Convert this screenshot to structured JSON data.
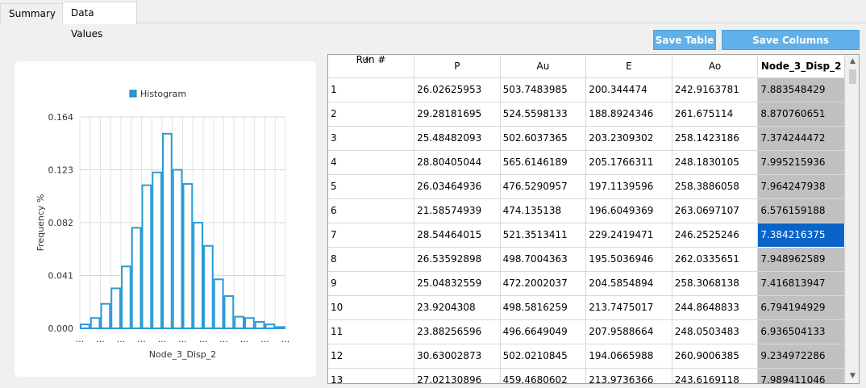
{
  "tabs": [
    {
      "label": "Summary",
      "active": false
    },
    {
      "label": "Data Values",
      "active": true
    }
  ],
  "buttons": {
    "save_table": "Save Table",
    "save_columns": "Save Columns Separately"
  },
  "colors": {
    "accent": "#62b0ea",
    "histogram": "#2a9bd7",
    "selection": "#0a64c8",
    "selected_column": "#c0c0c0"
  },
  "chart_data": {
    "type": "bar",
    "legend": "Histogram",
    "xlabel": "Node_3_Disp_2",
    "ylabel": "Frequency %",
    "y_ticks": [
      "0.164",
      "0.123",
      "0.082",
      "0.041",
      "0.000"
    ],
    "x_ticks": [
      "...",
      "...",
      "...",
      "...",
      "...",
      "...",
      "...",
      "...",
      "...",
      "...",
      "..."
    ],
    "ylim": [
      0,
      0.164
    ],
    "grid": true,
    "legend_position": "top",
    "values": [
      0.003,
      0.008,
      0.019,
      0.031,
      0.048,
      0.078,
      0.111,
      0.121,
      0.151,
      0.123,
      0.112,
      0.082,
      0.064,
      0.038,
      0.025,
      0.009,
      0.008,
      0.005,
      0.003,
      0.001
    ]
  },
  "table": {
    "columns": [
      "Run #",
      "P",
      "Au",
      "E",
      "Ao",
      "Node_3_Disp_2"
    ],
    "selected_column": "Node_3_Disp_2",
    "rows": [
      [
        "1",
        "26.02625953",
        "503.7483985",
        "200.344474",
        "242.9163781",
        "7.883548429"
      ],
      [
        "2",
        "29.28181695",
        "524.5598133",
        "188.8924346",
        "261.675114",
        "8.870760651"
      ],
      [
        "3",
        "25.48482093",
        "502.6037365",
        "203.2309302",
        "258.1423186",
        "7.374244472"
      ],
      [
        "4",
        "28.80405044",
        "565.6146189",
        "205.1766311",
        "248.1830105",
        "7.995215936"
      ],
      [
        "5",
        "26.03464936",
        "476.5290957",
        "197.1139596",
        "258.3886058",
        "7.964247938"
      ],
      [
        "6",
        "21.58574939",
        "474.135138",
        "196.6049369",
        "263.0697107",
        "6.576159188"
      ],
      [
        "7",
        "28.54464015",
        "521.3513411",
        "229.2419471",
        "246.2525246",
        "7.384216375"
      ],
      [
        "8",
        "26.53592898",
        "498.7004363",
        "195.5036946",
        "262.0335651",
        "7.948962589"
      ],
      [
        "9",
        "25.04832559",
        "472.2002037",
        "204.5854894",
        "258.3068138",
        "7.416813947"
      ],
      [
        "10",
        "23.9204308",
        "498.5816259",
        "213.7475017",
        "244.8648833",
        "6.794194929"
      ],
      [
        "11",
        "23.88256596",
        "496.6649049",
        "207.9588664",
        "248.0503483",
        "6.936504133"
      ],
      [
        "12",
        "30.63002873",
        "502.0210845",
        "194.0665988",
        "260.9006385",
        "9.234972286"
      ],
      [
        "13",
        "27.02130896",
        "459.4680602",
        "213.9736366",
        "243.6169118",
        "7.989411046"
      ]
    ],
    "current_row": 6
  }
}
